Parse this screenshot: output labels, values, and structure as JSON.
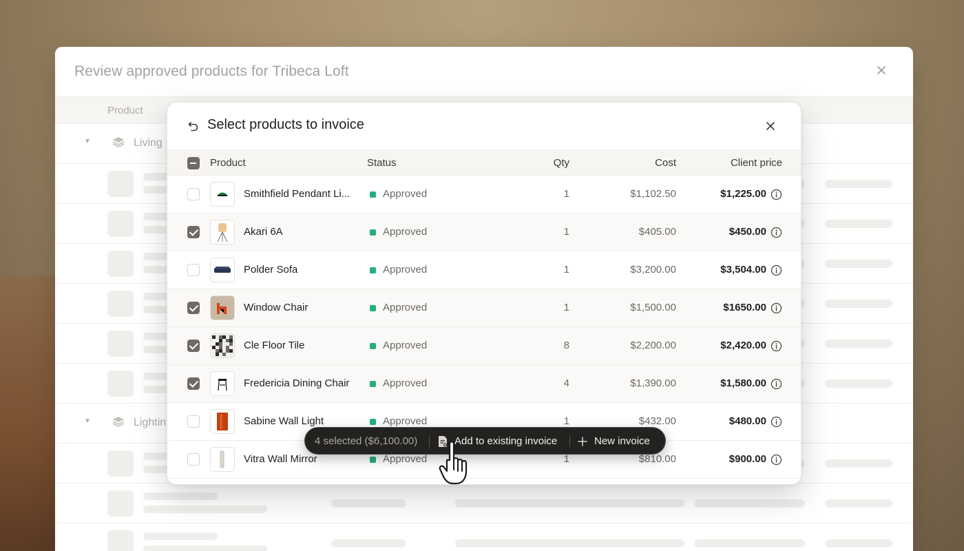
{
  "background_panel": {
    "title": "Review approved products for Tribeca Loft",
    "column_header": "Product",
    "groups": [
      "Living",
      "Lightin"
    ]
  },
  "modal": {
    "title": "Select products to invoice",
    "columns": {
      "product": "Product",
      "status": "Status",
      "qty": "Qty",
      "cost": "Cost",
      "client_price": "Client price"
    },
    "rows": [
      {
        "name": "Smithfield Pendant Li...",
        "status": "Approved",
        "qty": "1",
        "cost": "$1,102.50",
        "client_price": "$1,225.00",
        "checked": false
      },
      {
        "name": "Akari 6A",
        "status": "Approved",
        "qty": "1",
        "cost": "$405.00",
        "client_price": "$450.00",
        "checked": true
      },
      {
        "name": "Polder Sofa",
        "status": "Approved",
        "qty": "1",
        "cost": "$3,200.00",
        "client_price": "$3,504.00",
        "checked": false
      },
      {
        "name": "Window Chair",
        "status": "Approved",
        "qty": "1",
        "cost": "$1,500.00",
        "client_price": "$1650.00",
        "checked": true
      },
      {
        "name": "Cle Floor Tile",
        "status": "Approved",
        "qty": "8",
        "cost": "$2,200.00",
        "client_price": "$2,420.00",
        "checked": true
      },
      {
        "name": "Fredericia Dining Chair",
        "status": "Approved",
        "qty": "4",
        "cost": "$1,390.00",
        "client_price": "$1,580.00",
        "checked": true
      },
      {
        "name": "Sabine Wall Light",
        "status": "Approved",
        "qty": "1",
        "cost": "$432.00",
        "client_price": "$480.00",
        "checked": false
      },
      {
        "name": "Vitra Wall Mirror",
        "status": "Approved",
        "qty": "1",
        "cost": "$810.00",
        "client_price": "$900.00",
        "checked": false
      }
    ]
  },
  "action_bar": {
    "selection": "4 selected ($6,100.00)",
    "add_existing": "Add to existing invoice",
    "new_invoice": "New invoice"
  },
  "colors": {
    "status_approved": "#22b07d",
    "checkbox_checked": "#6f6a63",
    "action_bar_bg": "#232220"
  }
}
